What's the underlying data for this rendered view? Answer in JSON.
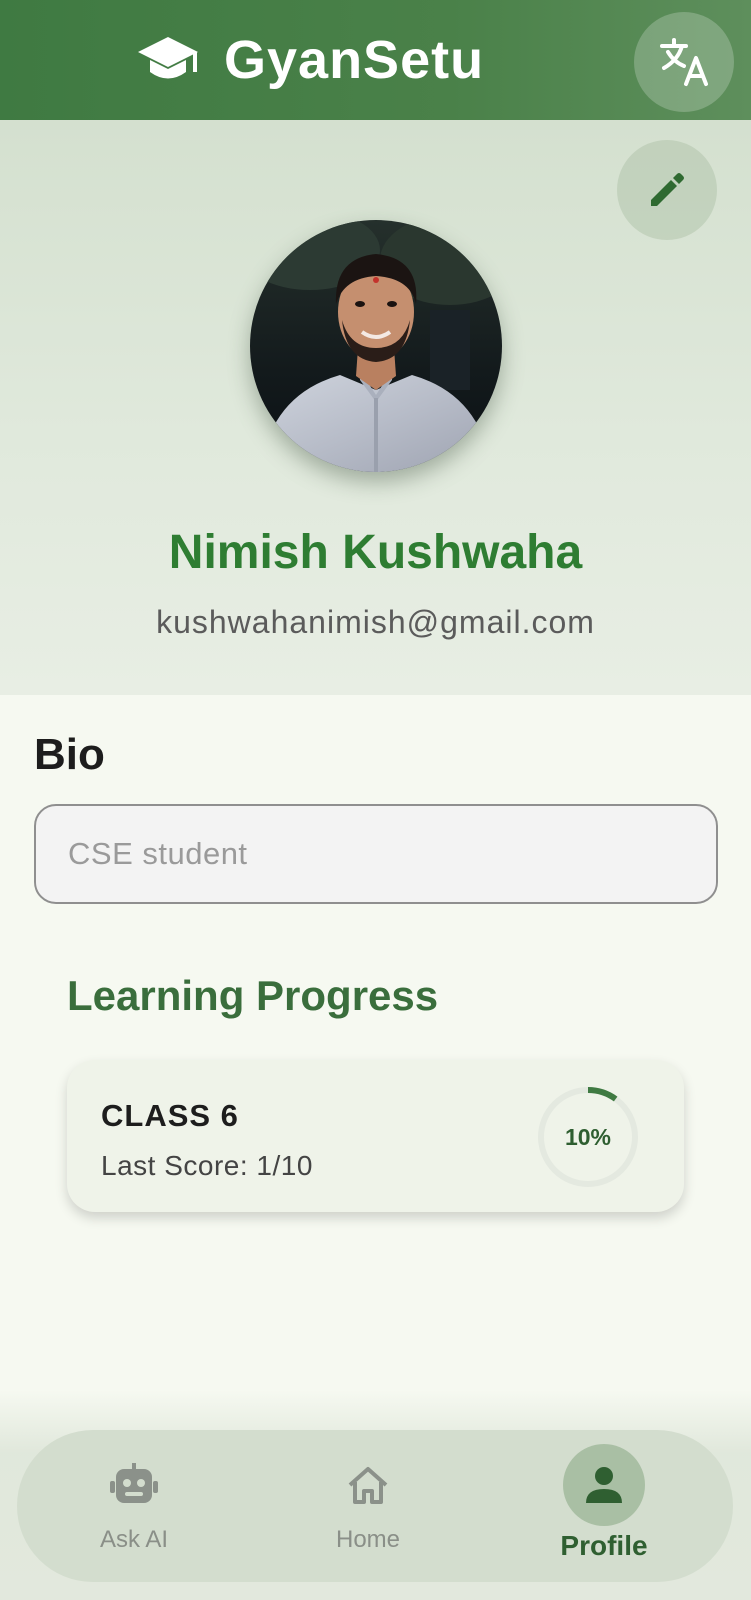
{
  "header": {
    "title": "GyanSetu",
    "logo_icon": "graduation-cap-icon",
    "translate_icon": "translate-icon"
  },
  "profile": {
    "edit_icon": "pencil-icon",
    "name": "Nimish Kushwaha",
    "email": "kushwahanimish@gmail.com"
  },
  "bio": {
    "heading": "Bio",
    "value": "CSE student"
  },
  "learning_progress": {
    "heading": "Learning Progress",
    "items": [
      {
        "class_name": "CLASS 6",
        "last_score": "Last Score: 1/10",
        "percent_label": "10%",
        "percent_value": 10
      }
    ]
  },
  "bottom_nav": {
    "items": [
      {
        "label": "Ask AI",
        "icon": "robot-icon",
        "active": false
      },
      {
        "label": "Home",
        "icon": "home-icon",
        "active": false
      },
      {
        "label": "Profile",
        "icon": "person-icon",
        "active": true
      }
    ]
  },
  "colors": {
    "header_green": "#3f7a42",
    "accent_green": "#2e7d32",
    "progress_green": "#3f7a42",
    "nav_background": "#d3ddce"
  }
}
